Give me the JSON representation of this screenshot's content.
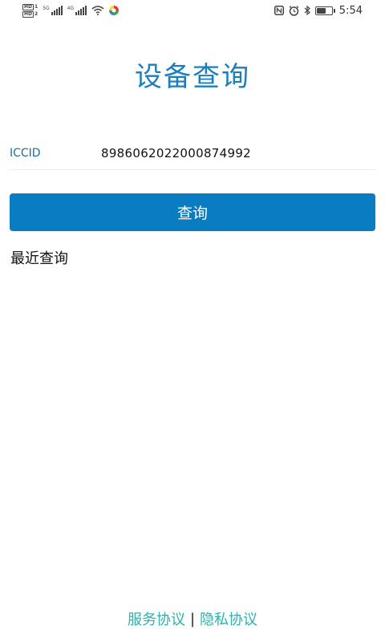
{
  "status_bar": {
    "sim1": "HD",
    "sim1_num": "1",
    "sim2": "HD",
    "sim2_num": "2",
    "net1": "5G",
    "net2": "4G",
    "time": "5:54"
  },
  "page": {
    "title": "设备查询"
  },
  "form": {
    "iccid_label": "ICCID",
    "iccid_value": "8986062022000874992"
  },
  "actions": {
    "query_label": "查询"
  },
  "recent": {
    "title": "最近查询"
  },
  "footer": {
    "service_agreement": "服务协议",
    "separator": "|",
    "privacy_agreement": "隐私协议"
  },
  "colors": {
    "accent": "#0a7cc2",
    "title": "#1a7fc1",
    "link": "#2bb3b1"
  },
  "icons": [
    "wifi-icon",
    "nfc-icon",
    "alarm-icon",
    "bluetooth-icon",
    "battery-icon"
  ]
}
